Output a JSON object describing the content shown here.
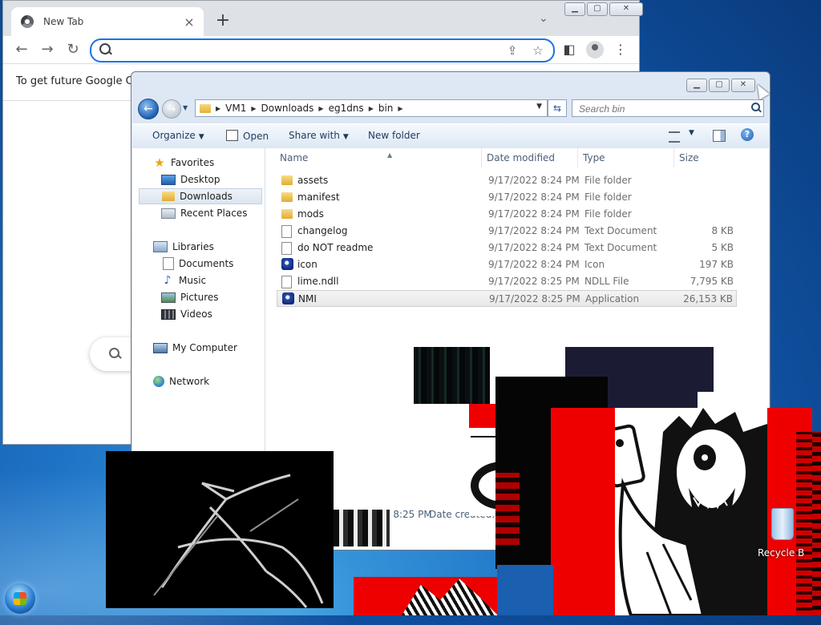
{
  "chrome": {
    "tab_title": "New Tab",
    "tab_close": "×",
    "new_tab": "+",
    "tab_search": "⌄",
    "controls": {
      "min": "▁",
      "max": "▢",
      "close": "✕"
    },
    "back": "←",
    "forward": "→",
    "reload": "↻",
    "omnibox_value": "",
    "share_icon": "⇪",
    "star_icon": "☆",
    "sidepanel_icon": "◧",
    "menu_icon": "⋮",
    "info_text": "To get future Google Chr"
  },
  "explorer": {
    "controls": {
      "min": "▁",
      "max": "▢",
      "close": "✕"
    },
    "back": "←",
    "forward": "→",
    "breadcrumb": [
      "VM1",
      "Downloads",
      "eg1dns",
      "bin"
    ],
    "refresh": "⇆",
    "search_placeholder": "Search bin",
    "commands": {
      "organize": "Organize",
      "open": "Open",
      "share_with": "Share with",
      "new_folder": "New folder"
    },
    "nav": {
      "favorites": "Favorites",
      "desktop": "Desktop",
      "downloads": "Downloads",
      "recent_places": "Recent Places",
      "libraries": "Libraries",
      "documents": "Documents",
      "music": "Music",
      "pictures": "Pictures",
      "videos": "Videos",
      "my_computer": "My Computer",
      "network": "Network"
    },
    "columns": {
      "name": "Name",
      "date": "Date modified",
      "type": "Type",
      "size": "Size"
    },
    "files": [
      {
        "icon": "folder",
        "name": "assets",
        "date": "9/17/2022 8:24 PM",
        "type": "File folder",
        "size": ""
      },
      {
        "icon": "folder",
        "name": "manifest",
        "date": "9/17/2022 8:24 PM",
        "type": "File folder",
        "size": ""
      },
      {
        "icon": "folder",
        "name": "mods",
        "date": "9/17/2022 8:24 PM",
        "type": "File folder",
        "size": ""
      },
      {
        "icon": "txt",
        "name": "changelog",
        "date": "9/17/2022 8:24 PM",
        "type": "Text Document",
        "size": "8 KB"
      },
      {
        "icon": "txt",
        "name": "do NOT readme",
        "date": "9/17/2022 8:24 PM",
        "type": "Text Document",
        "size": "5 KB"
      },
      {
        "icon": "ico",
        "name": "icon",
        "date": "9/17/2022 8:24 PM",
        "type": "Icon",
        "size": "197 KB"
      },
      {
        "icon": "txt",
        "name": "lime.ndll",
        "date": "9/17/2022 8:25 PM",
        "type": "NDLL File",
        "size": "7,795 KB"
      },
      {
        "icon": "ico",
        "name": "NMI",
        "date": "9/17/2022 8:25 PM",
        "type": "Application",
        "size": "26,153 KB"
      }
    ],
    "details": {
      "modified": "9/17/2022 8:25 PM",
      "created_label": "Date created: 12"
    }
  },
  "desktop": {
    "recycle_bin_label": "Recycle B"
  }
}
